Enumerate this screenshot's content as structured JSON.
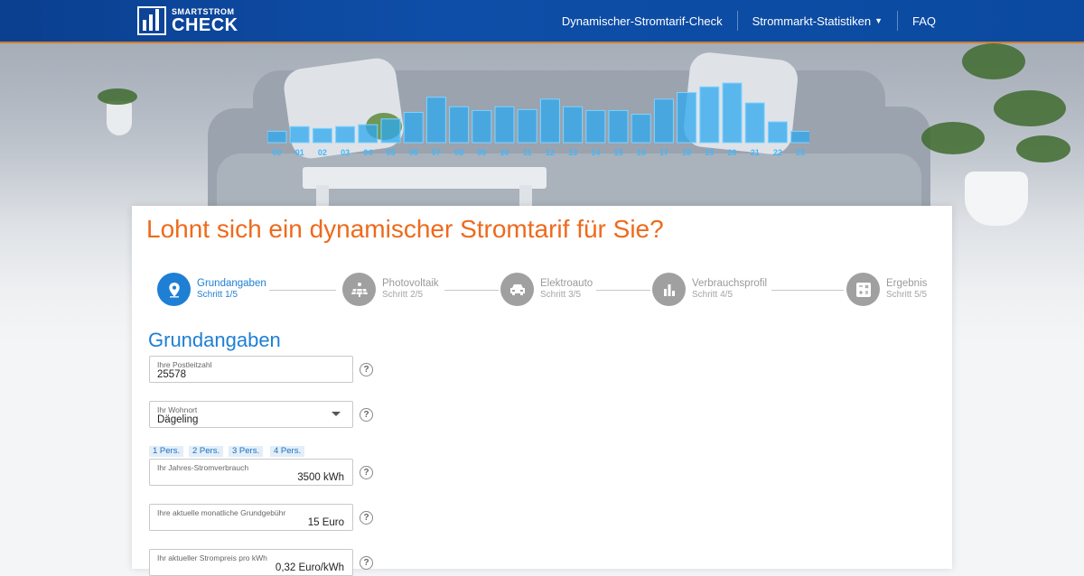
{
  "brand": {
    "small": "SMARTSTROM",
    "big": "CHECK"
  },
  "nav": {
    "items": [
      {
        "label": "Dynamischer-Stromtarif-Check"
      },
      {
        "label": "Strommarkt-Statistiken",
        "has_caret": true
      },
      {
        "label": "FAQ"
      }
    ]
  },
  "chart_data": {
    "type": "bar",
    "categories": [
      "00",
      "01",
      "02",
      "03",
      "04",
      "05",
      "06",
      "07",
      "08",
      "09",
      "10",
      "11",
      "12",
      "13",
      "14",
      "15",
      "16",
      "17",
      "18",
      "19",
      "20",
      "21",
      "22",
      "23"
    ],
    "values": [
      12,
      17,
      15,
      17,
      19,
      25,
      32,
      48,
      38,
      34,
      38,
      35,
      46,
      38,
      34,
      34,
      30,
      46,
      53,
      59,
      63,
      42,
      22,
      12
    ],
    "color": "#2ea8f0"
  },
  "card": {
    "title": "Lohnt sich ein dynamischer Stromtarif für Sie?",
    "steps": [
      {
        "label": "Grundangaben",
        "sub": "Schritt 1/5",
        "icon": "location-pin-icon",
        "active": true
      },
      {
        "label": "Photovoltaik",
        "sub": "Schritt 2/5",
        "icon": "solar-panel-icon",
        "active": false
      },
      {
        "label": "Elektroauto",
        "sub": "Schritt 3/5",
        "icon": "car-icon",
        "active": false
      },
      {
        "label": "Verbrauchsprofil",
        "sub": "Schritt 4/5",
        "icon": "bar-chart-icon",
        "active": false
      },
      {
        "label": "Ergebnis",
        "sub": "Schritt 5/5",
        "icon": "calculator-icon",
        "active": false
      }
    ],
    "section_title": "Grundangaben",
    "form": {
      "postleitzahl": {
        "label": "Ihre Postleitzahl",
        "value": "25578"
      },
      "wohnort": {
        "label": "Ihr Wohnort",
        "value": "Dägeling"
      },
      "persons": [
        "1 Pers.",
        "2 Pers.",
        "3 Pers.",
        "4 Pers."
      ],
      "jahresverbrauch": {
        "label": "Ihr Jahres-Stromverbrauch",
        "value": "3500 kWh"
      },
      "grundgebuehr": {
        "label": "Ihre aktuelle monatliche Grundgebühr",
        "value": "15 Euro"
      },
      "strompreis": {
        "label": "Ihr aktueller Strompreis pro kWh",
        "value": "0,32 Euro/kWh"
      },
      "help_symbol": "?"
    }
  }
}
